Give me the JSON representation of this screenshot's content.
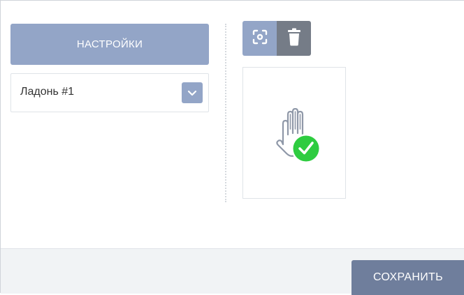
{
  "settings_label": "Настройки",
  "palm_select": {
    "value": "Ладонь #1"
  },
  "toolbar": {
    "scan_icon": "scan-icon",
    "delete_icon": "trash-icon"
  },
  "palm_card": {
    "icon": "palm-hand-icon",
    "status": "enrolled",
    "status_icon": "check-circle-icon"
  },
  "footer": {
    "save_label": "СОХРАНИТЬ"
  },
  "colors": {
    "primary": "#93a5c7",
    "dark": "#757c87",
    "save": "#6f7e9c",
    "success": "#2ecc40",
    "footer_bg": "#f1f3f5"
  }
}
